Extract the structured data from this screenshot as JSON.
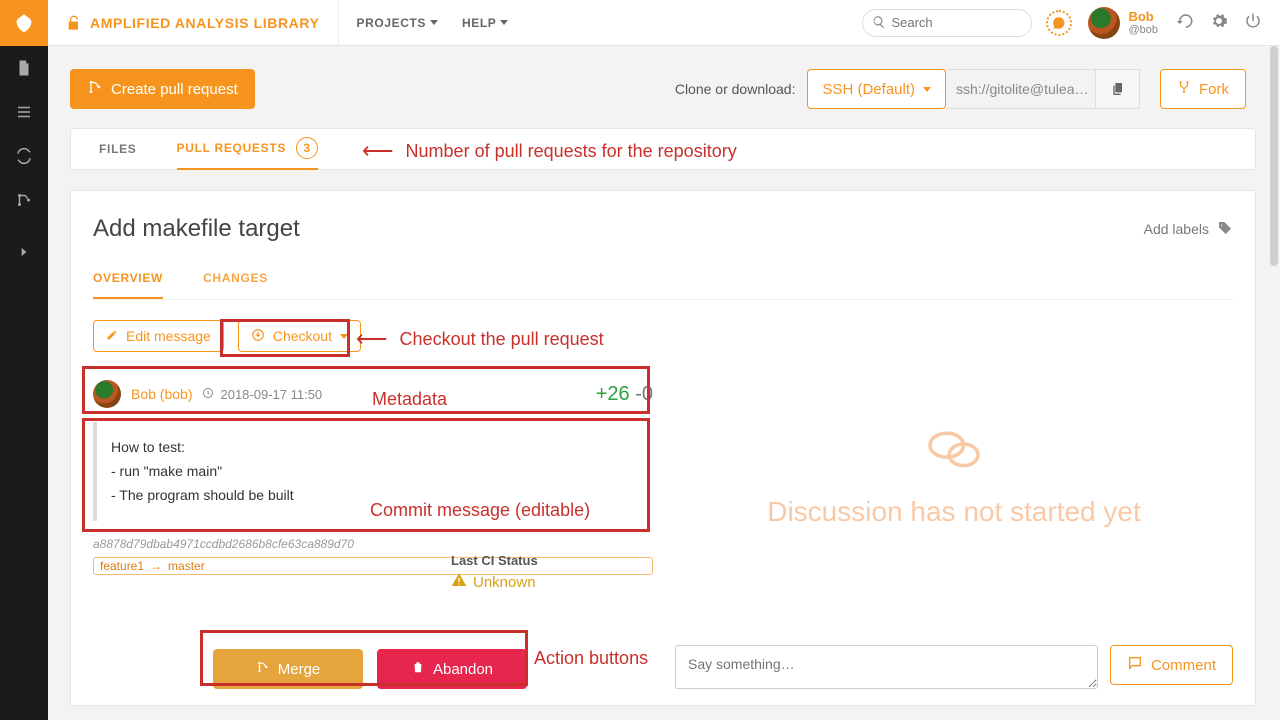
{
  "project": {
    "title": "AMPLIFIED ANALYSIS LIBRARY"
  },
  "topnav": {
    "projects": "PROJECTS",
    "help": "HELP"
  },
  "search": {
    "placeholder": "Search"
  },
  "user": {
    "name": "Bob",
    "handle": "@bob"
  },
  "toolbar": {
    "create_pr": "Create pull request",
    "clone_label": "Clone or download:",
    "ssh_label": "SSH (Default)",
    "clone_url": "ssh://gitolite@tulea…",
    "fork": "Fork"
  },
  "repo_tabs": {
    "files": "FILES",
    "prs": "PULL REQUESTS",
    "pr_count": "3"
  },
  "annotations": {
    "pr_count": "Number of pull requests for the repository",
    "checkout": "Checkout the pull request",
    "metadata": "Metadata",
    "commit": "Commit message (editable)",
    "actions": "Action buttons"
  },
  "pr": {
    "title": "Add makefile target",
    "add_labels": "Add labels",
    "tabs": {
      "overview": "OVERVIEW",
      "changes": "CHANGES"
    },
    "edit_message": "Edit message",
    "checkout": "Checkout",
    "author": "Bob (bob)",
    "date": "2018-09-17 11:50",
    "additions": "+26",
    "deletions": "-0",
    "msg_line1": "How to test:",
    "msg_line2": "- run \"make main\"",
    "msg_line3": "- The program should be built",
    "hash": "a8878d79dbab4971ccdbd2686b8cfe63ca889d70",
    "branch_src": "feature1",
    "branch_dst": "master",
    "ci_label": "Last CI Status",
    "ci_value": "Unknown",
    "merge": "Merge",
    "abandon": "Abandon"
  },
  "discussion": {
    "empty": "Discussion has not started yet",
    "placeholder": "Say something…",
    "comment": "Comment"
  }
}
